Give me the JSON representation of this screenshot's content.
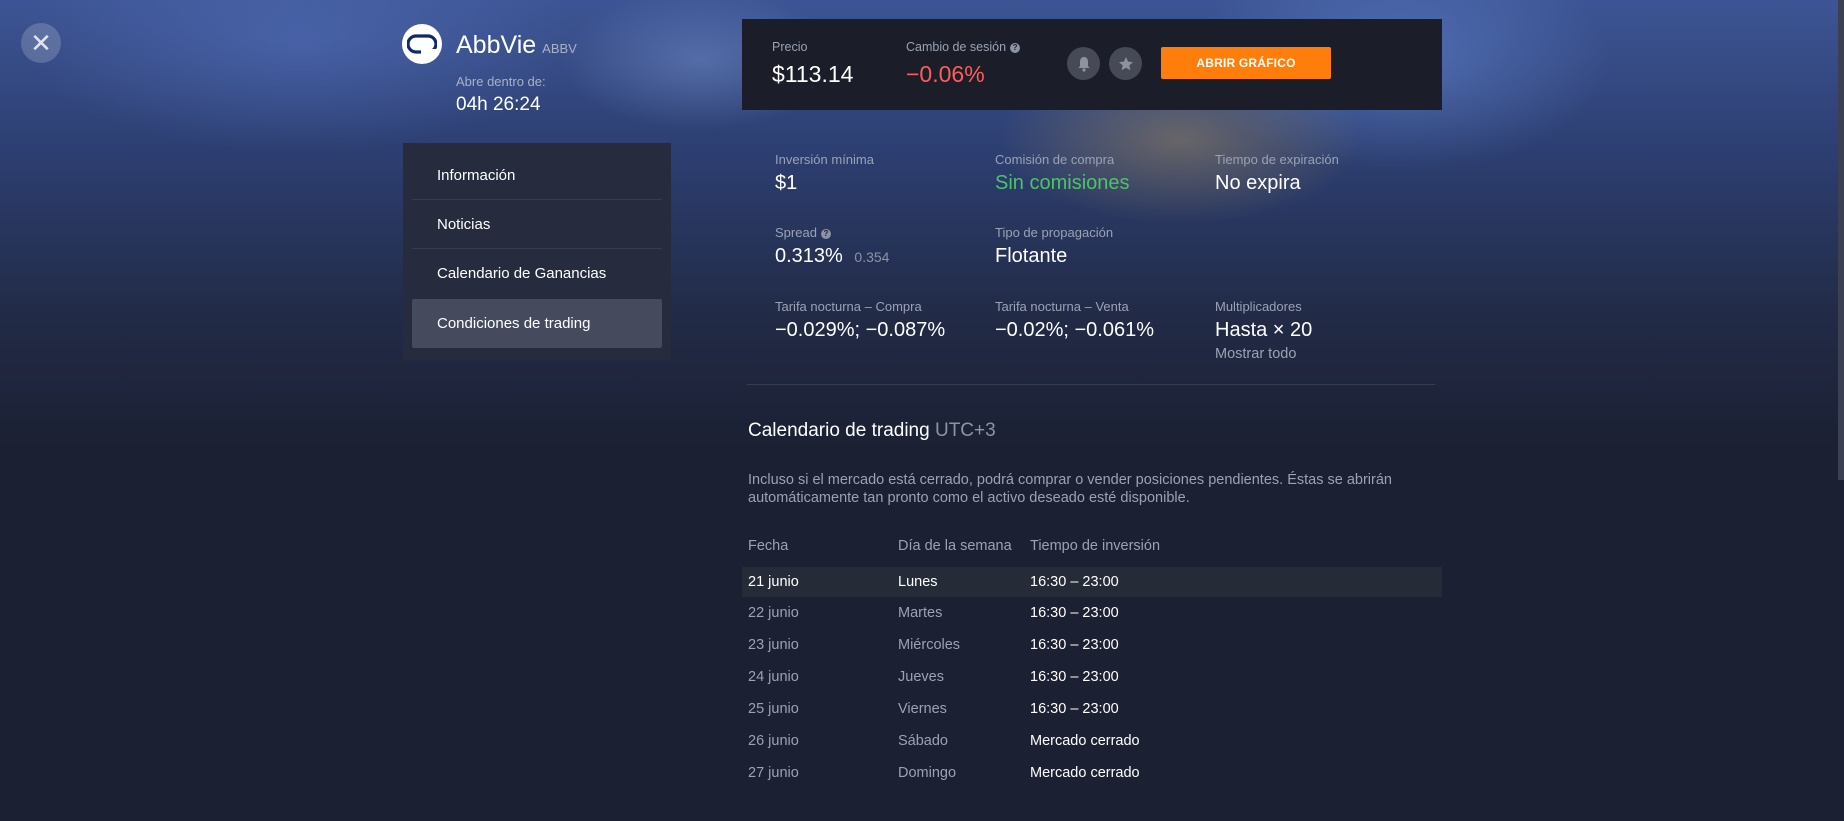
{
  "asset": {
    "name": "AbbVie",
    "ticker": "ABBV",
    "opens_label": "Abre dentro de:",
    "opens_value": "04h 26:24"
  },
  "close_icon": "close-icon",
  "sidebar": {
    "items": [
      {
        "label": "Información",
        "active": false
      },
      {
        "label": "Noticias",
        "active": false
      },
      {
        "label": "Calendario de Ganancias",
        "active": false
      },
      {
        "label": "Condiciones de trading",
        "active": true
      }
    ]
  },
  "price_panel": {
    "price_label": "Precio",
    "price_value": "$113.14",
    "change_label": "Cambio de sesión",
    "change_value": "−0.06%",
    "change_color": "#ff5c5c",
    "alert_icon": "bell-icon",
    "favorite_icon": "star-icon",
    "open_chart_label": "ABRIR GRÁFICO"
  },
  "stats": {
    "min_investment_label": "Inversión mínima",
    "min_investment_value": "$1",
    "commission_label": "Comisión de compra",
    "commission_value": "Sin comisiones",
    "commission_color": "#4cc36a",
    "expiration_label": "Tiempo de expiración",
    "expiration_value": "No expira",
    "spread_label": "Spread",
    "spread_value": "0.313%",
    "spread_secondary": "0.354",
    "spread_type_label": "Tipo de propagación",
    "spread_type_value": "Flotante",
    "overnight_buy_label": "Tarifa nocturna – Compra",
    "overnight_buy_value": "−0.029%; −0.087%",
    "overnight_sell_label": "Tarifa nocturna – Venta",
    "overnight_sell_value": "−0.02%; −0.061%",
    "multipliers_label": "Multiplicadores",
    "multipliers_value": "Hasta × 20",
    "show_all_label": "Mostrar todo"
  },
  "calendar": {
    "title": "Calendario de trading",
    "timezone": "UTC+3",
    "description": "Incluso si el mercado está cerrado, podrá comprar o vender posiciones pendientes. Éstas se abrirán automáticamente tan pronto como el activo deseado esté disponible.",
    "headers": {
      "date": "Fecha",
      "weekday": "Día de la semana",
      "time": "Tiempo de inversión"
    },
    "rows": [
      {
        "date": "21 junio",
        "weekday": "Lunes",
        "time": "16:30 – 23:00"
      },
      {
        "date": "22 junio",
        "weekday": "Martes",
        "time": "16:30 – 23:00"
      },
      {
        "date": "23 junio",
        "weekday": "Miércoles",
        "time": "16:30 – 23:00"
      },
      {
        "date": "24 junio",
        "weekday": "Jueves",
        "time": "16:30 – 23:00"
      },
      {
        "date": "25 junio",
        "weekday": "Viernes",
        "time": "16:30 – 23:00"
      },
      {
        "date": "26 junio",
        "weekday": "Sábado",
        "time": "Mercado cerrado"
      },
      {
        "date": "27 junio",
        "weekday": "Domingo",
        "time": "Mercado cerrado"
      }
    ]
  }
}
